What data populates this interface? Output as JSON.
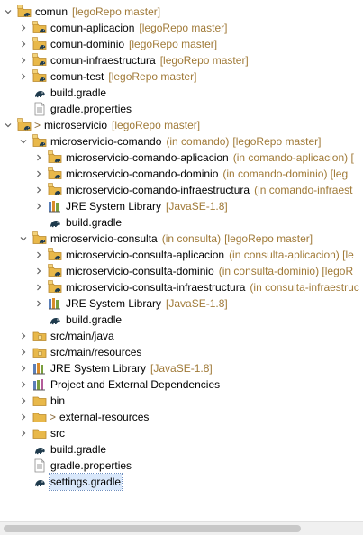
{
  "tree": [
    {
      "depth": 0,
      "expand": "down",
      "icon": "gradle-project-icon",
      "text": "comun",
      "decoration": "[legoRepo master]"
    },
    {
      "depth": 1,
      "expand": "right",
      "icon": "gradle-project-icon",
      "text": "comun-aplicacion",
      "decoration": "[legoRepo master]"
    },
    {
      "depth": 1,
      "expand": "right",
      "icon": "gradle-project-icon",
      "text": "comun-dominio",
      "decoration": "[legoRepo master]"
    },
    {
      "depth": 1,
      "expand": "right",
      "icon": "gradle-project-icon",
      "text": "comun-infraestructura",
      "decoration": "[legoRepo master]"
    },
    {
      "depth": 1,
      "expand": "right",
      "icon": "gradle-project-icon",
      "text": "comun-test",
      "decoration": "[legoRepo master]"
    },
    {
      "depth": 1,
      "expand": "none",
      "icon": "gradle-elephant-icon",
      "text": "build.gradle"
    },
    {
      "depth": 1,
      "expand": "none",
      "icon": "properties-file-icon",
      "text": "gradle.properties"
    },
    {
      "depth": 0,
      "expand": "down",
      "icon": "gradle-project-icon",
      "prefix": ">",
      "text": "microservicio",
      "decoration": "[legoRepo master]"
    },
    {
      "depth": 1,
      "expand": "down",
      "icon": "gradle-project-icon",
      "text": "microservicio-comando",
      "location": "(in comando)",
      "decoration": "[legoRepo master]"
    },
    {
      "depth": 2,
      "expand": "right",
      "icon": "gradle-project-icon",
      "text": "microservicio-comando-aplicacion",
      "location": "(in comando-aplicacion) [",
      "decoration": ""
    },
    {
      "depth": 2,
      "expand": "right",
      "icon": "gradle-project-icon",
      "text": "microservicio-comando-dominio",
      "location": "(in comando-dominio) [leg"
    },
    {
      "depth": 2,
      "expand": "right",
      "icon": "gradle-project-icon",
      "text": "microservicio-comando-infraestructura",
      "location": "(in comando-infraest"
    },
    {
      "depth": 2,
      "expand": "right",
      "icon": "jre-library-icon",
      "text": "JRE System Library",
      "decoration": "[JavaSE-1.8]"
    },
    {
      "depth": 2,
      "expand": "none",
      "icon": "gradle-elephant-icon",
      "text": "build.gradle"
    },
    {
      "depth": 1,
      "expand": "down",
      "icon": "gradle-project-icon",
      "text": "microservicio-consulta",
      "location": "(in consulta)",
      "decoration": "[legoRepo master]"
    },
    {
      "depth": 2,
      "expand": "right",
      "icon": "gradle-project-icon",
      "text": "microservicio-consulta-aplicacion",
      "location": "(in consulta-aplicacion) [le"
    },
    {
      "depth": 2,
      "expand": "right",
      "icon": "gradle-project-icon",
      "text": "microservicio-consulta-dominio",
      "location": "(in consulta-dominio) [legoR"
    },
    {
      "depth": 2,
      "expand": "right",
      "icon": "gradle-project-icon",
      "text": "microservicio-consulta-infraestructura",
      "location": "(in consulta-infraestruc"
    },
    {
      "depth": 2,
      "expand": "right",
      "icon": "jre-library-icon",
      "text": "JRE System Library",
      "decoration": "[JavaSE-1.8]"
    },
    {
      "depth": 2,
      "expand": "none",
      "icon": "gradle-elephant-icon",
      "text": "build.gradle"
    },
    {
      "depth": 1,
      "expand": "right",
      "icon": "source-folder-icon",
      "text": "src/main/java"
    },
    {
      "depth": 1,
      "expand": "right",
      "icon": "source-folder-icon",
      "text": "src/main/resources"
    },
    {
      "depth": 1,
      "expand": "right",
      "icon": "jre-library-icon",
      "text": "JRE System Library",
      "decoration": "[JavaSE-1.8]"
    },
    {
      "depth": 1,
      "expand": "right",
      "icon": "dependencies-library-icon",
      "text": "Project and External Dependencies"
    },
    {
      "depth": 1,
      "expand": "right",
      "icon": "folder-icon",
      "text": "bin"
    },
    {
      "depth": 1,
      "expand": "right",
      "icon": "folder-icon",
      "prefix": ">",
      "text": "external-resources"
    },
    {
      "depth": 1,
      "expand": "right",
      "icon": "folder-icon",
      "text": "src"
    },
    {
      "depth": 1,
      "expand": "none",
      "icon": "gradle-elephant-icon",
      "text": "build.gradle"
    },
    {
      "depth": 1,
      "expand": "none",
      "icon": "properties-file-icon",
      "text": "gradle.properties"
    },
    {
      "depth": 1,
      "expand": "none",
      "icon": "gradle-elephant-icon",
      "text": "settings.gradle",
      "selected": true
    }
  ],
  "colors": {
    "decoration": "#a07a38",
    "selection": "#d9e8fb",
    "chevron": "#606060",
    "scrollbar_track": "#f0f0f0",
    "scrollbar_thumb": "#c8c8c8"
  }
}
